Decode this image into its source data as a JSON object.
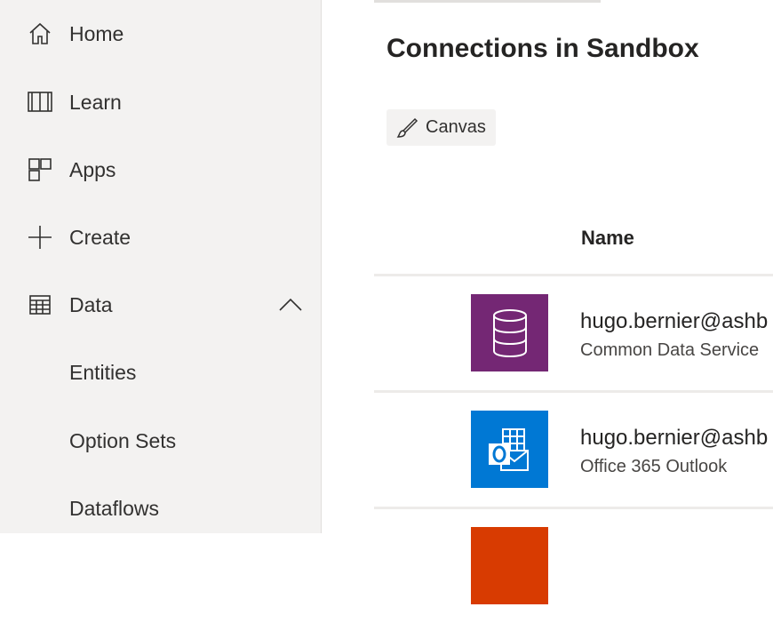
{
  "sidebar": {
    "items": [
      {
        "label": "Home",
        "icon": "home-icon"
      },
      {
        "label": "Learn",
        "icon": "book-icon"
      },
      {
        "label": "Apps",
        "icon": "apps-icon"
      },
      {
        "label": "Create",
        "icon": "plus-icon"
      },
      {
        "label": "Data",
        "icon": "table-icon",
        "expanded": true
      },
      {
        "label": "Entities"
      },
      {
        "label": "Option Sets"
      },
      {
        "label": "Dataflows"
      }
    ]
  },
  "main": {
    "title": "Connections in Sandbox",
    "filter": {
      "label": "Canvas",
      "icon": "brush-icon"
    },
    "table": {
      "header": "Name",
      "rows": [
        {
          "title": "hugo.bernier@ashb",
          "subtitle": "Common Data Service",
          "icon": "database-icon",
          "color": "#742774"
        },
        {
          "title": "hugo.bernier@ashb",
          "subtitle": "Office 365 Outlook",
          "icon": "outlook-icon",
          "color": "#0078d4"
        },
        {
          "title": "",
          "subtitle": "",
          "icon": "office-icon",
          "color": "#d83b01"
        }
      ]
    }
  },
  "colors": {
    "sidebar_bg": "#f3f2f1",
    "cds_purple": "#742774",
    "outlook_blue": "#0078d4",
    "office_orange": "#d83b01"
  }
}
